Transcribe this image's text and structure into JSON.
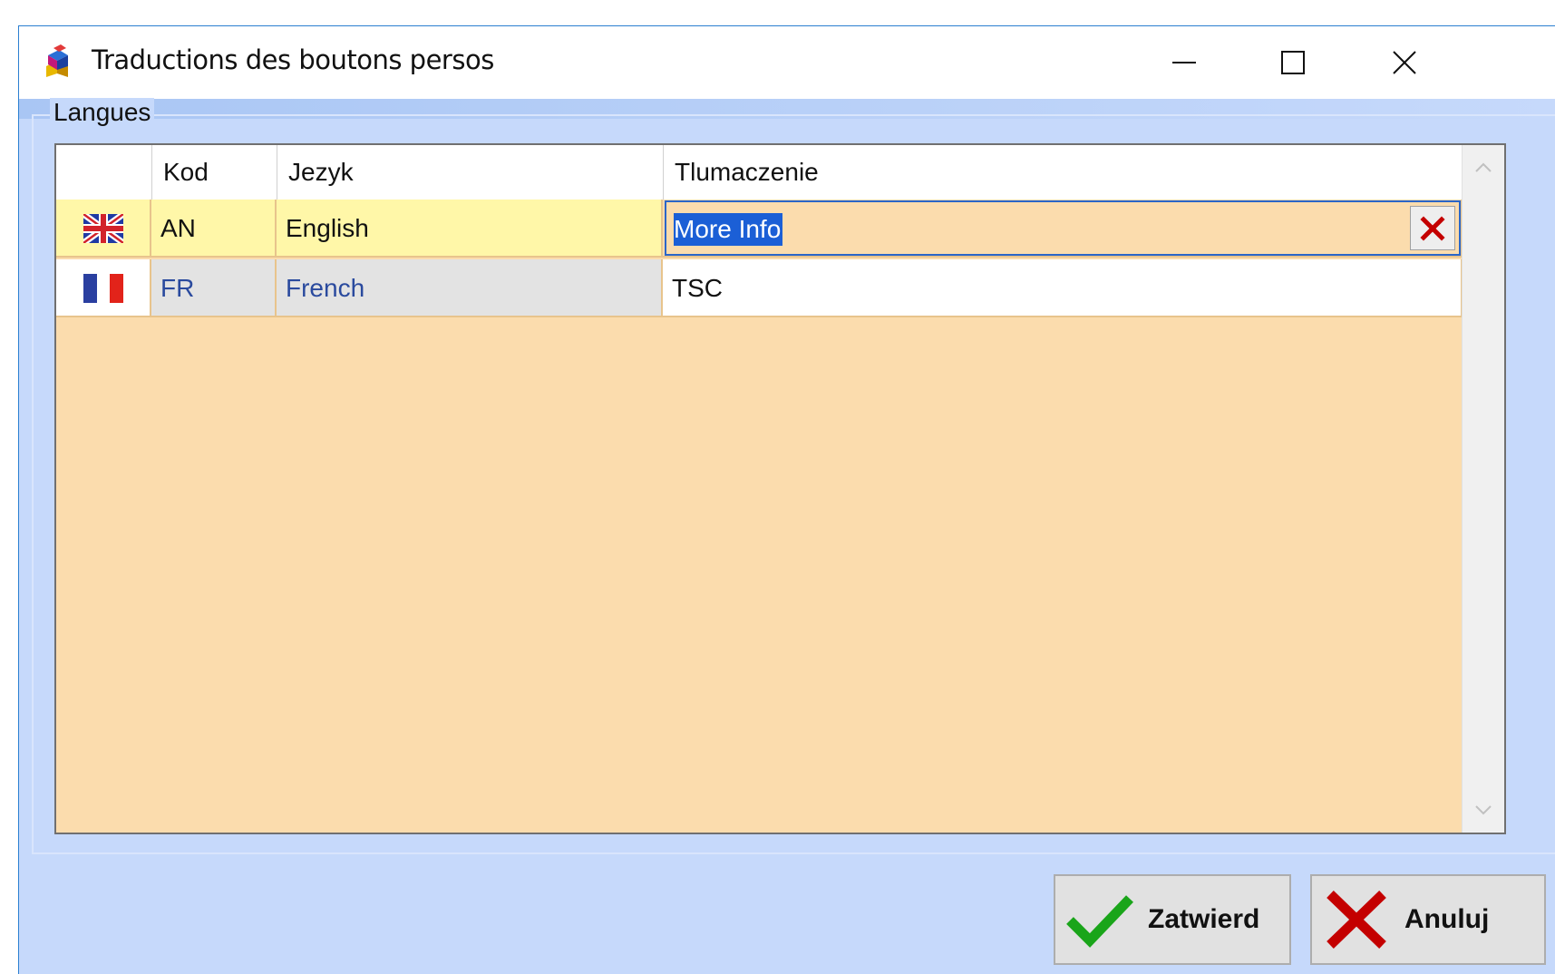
{
  "window": {
    "title": "Traductions des boutons persos",
    "icon": "app-cube-icon",
    "controls": [
      "minimize-icon",
      "maximize-icon",
      "close-icon"
    ]
  },
  "group": {
    "label": "Langues"
  },
  "grid": {
    "columns": [
      "",
      "Kod",
      "Jezyk",
      "Tlumaczenie"
    ],
    "rows": [
      {
        "flag": "uk-flag-icon",
        "code": "AN",
        "language": "English",
        "translation": "More Info",
        "state": "editing"
      },
      {
        "flag": "fr-flag-icon",
        "code": "FR",
        "language": "French",
        "translation": "TSC",
        "state": "normal"
      }
    ]
  },
  "buttons": {
    "ok_label": "Zatwierd",
    "cancel_label": "Anuluj"
  },
  "colors": {
    "window_bg": "#c6d9fb",
    "grid_bg": "#fbdcad",
    "selected_row": "#fff7a8",
    "selection_highlight": "#1b5fd6",
    "row_readonly": "#e3e3e3",
    "check_green": "#1aa51a",
    "cross_red": "#c40000"
  }
}
